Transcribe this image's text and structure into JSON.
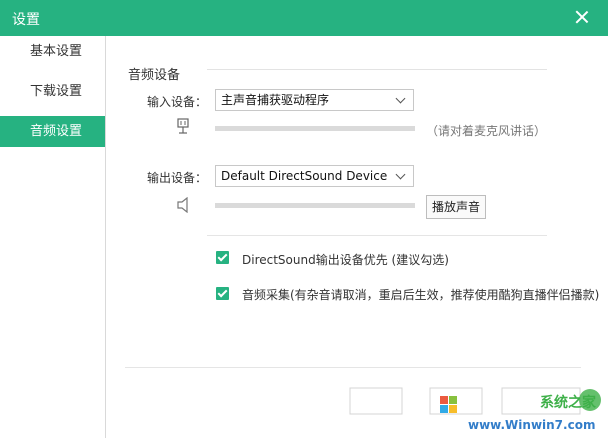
{
  "window": {
    "title": "设置"
  },
  "sidebar": {
    "items": [
      {
        "label": "基本设置"
      },
      {
        "label": "下载设置"
      },
      {
        "label": "音频设置"
      }
    ]
  },
  "audio": {
    "section_title": "音频设备",
    "input": {
      "label": "输入设备：",
      "selected": "主声音捕获驱动程序",
      "hint": "（请对着麦克风讲话）"
    },
    "output": {
      "label": "输出设备：",
      "selected": "Default DirectSound Device",
      "play_button": "播放声音"
    },
    "options": [
      {
        "label": "DirectSound输出设备优先 (建议勾选)",
        "checked": true
      },
      {
        "label": "音频采集(有杂音请取消，重启后生效，推荐使用酷狗直播伴侣播款)",
        "checked": true
      }
    ]
  },
  "footer": {
    "watermark": "Winwin7.com",
    "watermark_site": "www.Winwin7.com",
    "watermark_brand": "系统之家"
  },
  "colors": {
    "accent": "#26b281"
  }
}
